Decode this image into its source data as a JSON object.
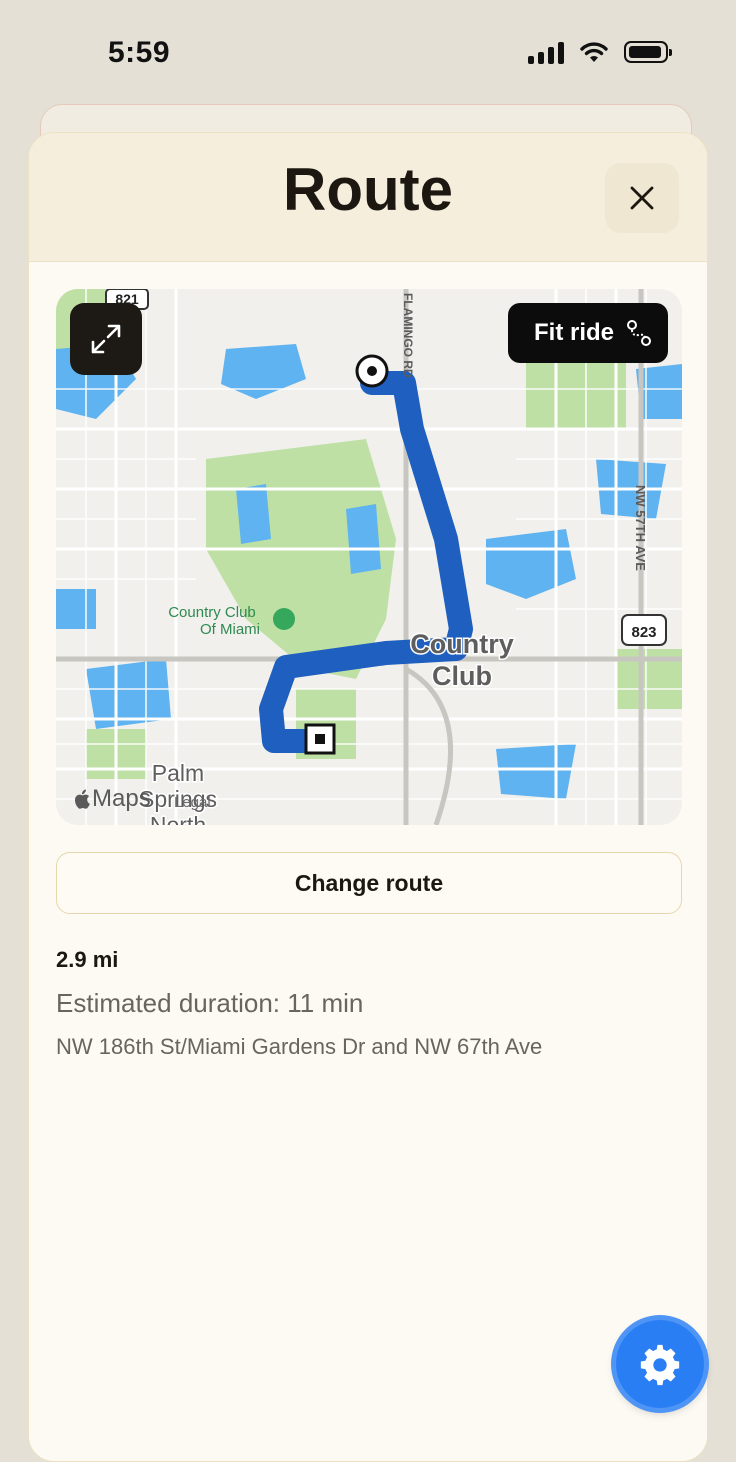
{
  "status_bar": {
    "time": "5:59"
  },
  "sheet": {
    "title": "Route"
  },
  "map": {
    "fit_ride_label": "Fit ride",
    "maps_label": "Maps",
    "legal_label": "Legal",
    "labels": {
      "road_flamingo": "FLAMINGO RD",
      "road_nw57": "NW 57TH AVE",
      "place_country_club_1": "Country Club",
      "place_country_club_2": "Of Miami",
      "area_country": "Country",
      "area_club": "Club",
      "area_palm": "Palm",
      "area_springs": "Springs",
      "area_north": "North",
      "shield_823": "823",
      "shield_821": "821"
    }
  },
  "route": {
    "change_route_label": "Change route",
    "distance": "2.9 mi",
    "duration": "Estimated duration: 11 min",
    "street": "NW 186th St/Miami Gardens Dr and NW 67th Ave"
  },
  "colors": {
    "route": "#1f5fbf",
    "accent": "#2a7ef4",
    "water": "#5fb3f0",
    "park": "#bfe0a4"
  },
  "icons": [
    "signal-icon",
    "wifi-icon",
    "battery-icon",
    "close-icon",
    "expand-icon",
    "route-icon",
    "apple-logo-icon",
    "gear-icon"
  ]
}
